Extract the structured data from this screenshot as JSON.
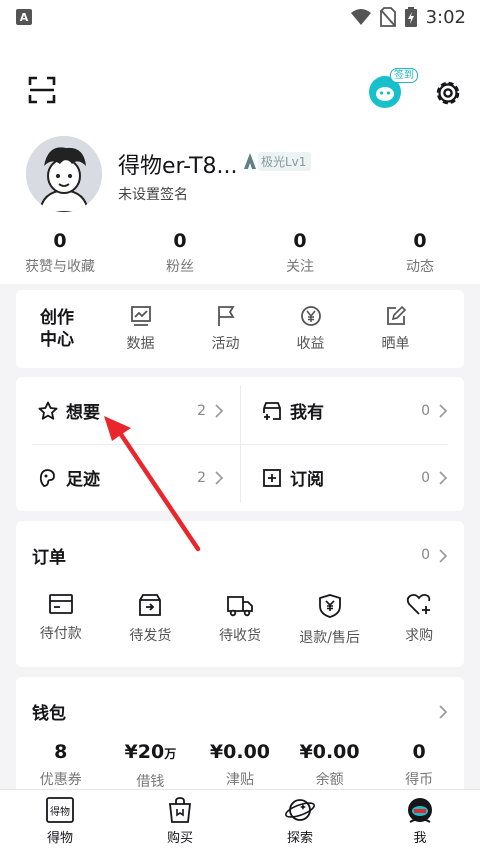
{
  "status_bar": {
    "time": "3:02",
    "app_badge": "A"
  },
  "header": {
    "checkin_badge": "签到"
  },
  "profile": {
    "nickname": "得物er-T8...",
    "level_badge": "极光Lv1",
    "signature": "未设置签名",
    "stats": [
      {
        "value": "0",
        "label": "获赞与收藏"
      },
      {
        "value": "0",
        "label": "粉丝"
      },
      {
        "value": "0",
        "label": "关注"
      },
      {
        "value": "0",
        "label": "动态"
      }
    ]
  },
  "creator_center": {
    "title_line1": "创作",
    "title_line2": "中心",
    "items": [
      {
        "label": "数据",
        "icon": "chart-icon"
      },
      {
        "label": "活动",
        "icon": "flag-icon"
      },
      {
        "label": "收益",
        "icon": "yen-icon"
      },
      {
        "label": "晒单",
        "icon": "edit-icon"
      }
    ]
  },
  "shortcuts": [
    {
      "label": "想要",
      "count": "2",
      "icon": "star-icon"
    },
    {
      "label": "我有",
      "count": "0",
      "icon": "box-add-icon"
    },
    {
      "label": "足迹",
      "count": "2",
      "icon": "footprint-icon"
    },
    {
      "label": "订阅",
      "count": "0",
      "icon": "subscribe-icon"
    }
  ],
  "orders": {
    "title": "订单",
    "count": "0",
    "items": [
      {
        "label": "待付款",
        "icon": "card-icon"
      },
      {
        "label": "待发货",
        "icon": "package-icon"
      },
      {
        "label": "待收货",
        "icon": "truck-icon"
      },
      {
        "label": "退款/售后",
        "icon": "shield-yen-icon"
      },
      {
        "label": "求购",
        "icon": "heart-plus-icon"
      }
    ]
  },
  "wallet": {
    "title": "钱包",
    "items": [
      {
        "value": "8",
        "unit": "",
        "label": "优惠券"
      },
      {
        "value": "¥20",
        "unit": "万",
        "label": "借钱"
      },
      {
        "value": "¥0.00",
        "unit": "",
        "label": "津贴"
      },
      {
        "value": "¥0.00",
        "unit": "",
        "label": "余额"
      },
      {
        "value": "0",
        "unit": "",
        "label": "得币"
      }
    ]
  },
  "tabbar": [
    {
      "label": "得物",
      "icon": "dewu-icon",
      "glyph": "得物"
    },
    {
      "label": "购买",
      "icon": "shopping-bag-icon"
    },
    {
      "label": "探索",
      "icon": "planet-icon"
    },
    {
      "label": "我",
      "icon": "avatar-icon"
    }
  ],
  "colors": {
    "accent": "#16c1cc",
    "annotation_arrow": "#e8262b"
  }
}
